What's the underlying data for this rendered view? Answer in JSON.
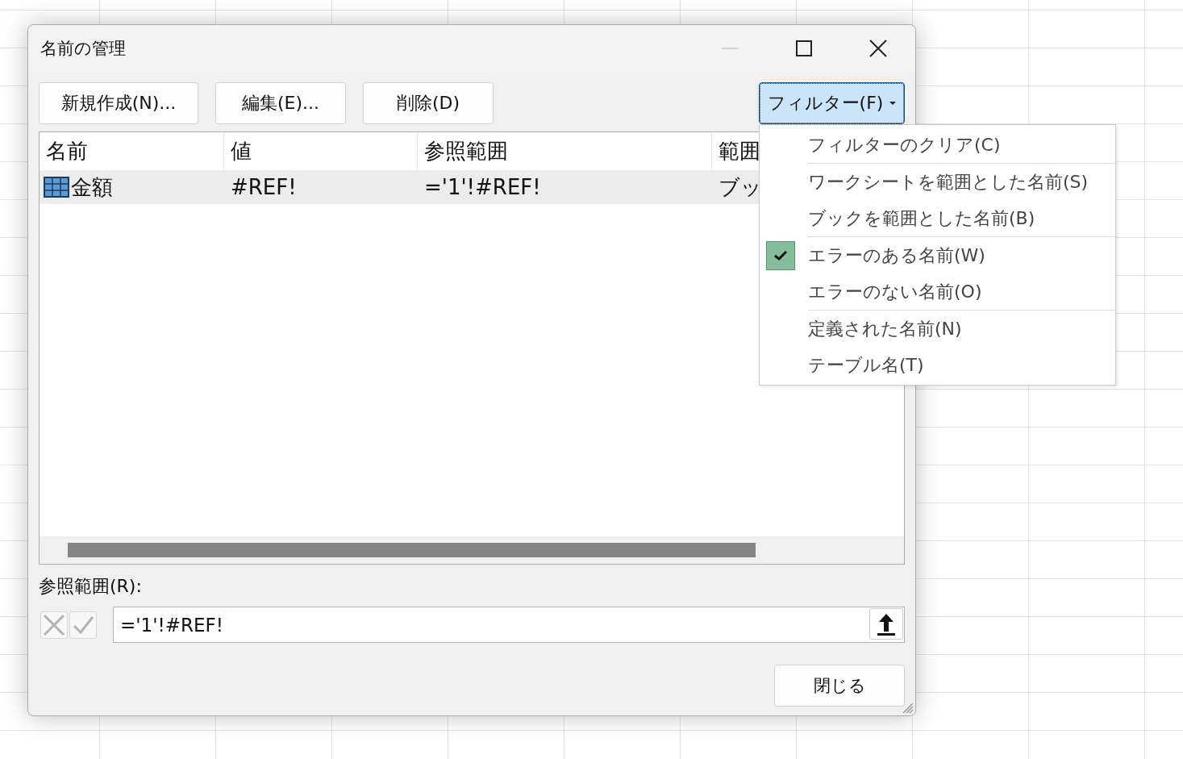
{
  "window": {
    "title": "名前の管理",
    "minimize_disabled": true
  },
  "buttons": [
    {
      "label": "新規作成(N)..."
    },
    {
      "label": "編集(E)..."
    },
    {
      "label": "削除(D)"
    }
  ],
  "filter_button": {
    "label": "フィルター(F)",
    "expanded": true
  },
  "table": {
    "columns": [
      "名前",
      "値",
      "参照範囲",
      "範囲"
    ],
    "rows": [
      {
        "kind": "table",
        "selected": true,
        "cells": [
          "金額",
          "#REF!",
          "='1'!#REF!",
          "ブッ"
        ]
      }
    ]
  },
  "filter_menu": {
    "groups": [
      [
        {
          "label": "フィルターのクリア(C)",
          "checked": false
        }
      ],
      [
        {
          "label": "ワークシートを範囲とした名前(S)",
          "checked": false
        },
        {
          "label": "ブックを範囲とした名前(B)",
          "checked": false
        }
      ],
      [
        {
          "label": "エラーのある名前(W)",
          "checked": true
        },
        {
          "label": "エラーのない名前(O)",
          "checked": false
        }
      ],
      [
        {
          "label": "定義された名前(N)",
          "checked": false
        },
        {
          "label": "テーブル名(T)",
          "checked": false
        }
      ]
    ]
  },
  "reference": {
    "label": "参照範囲(R):",
    "value": "='1'!#REF!"
  },
  "close_button": "閉じる"
}
